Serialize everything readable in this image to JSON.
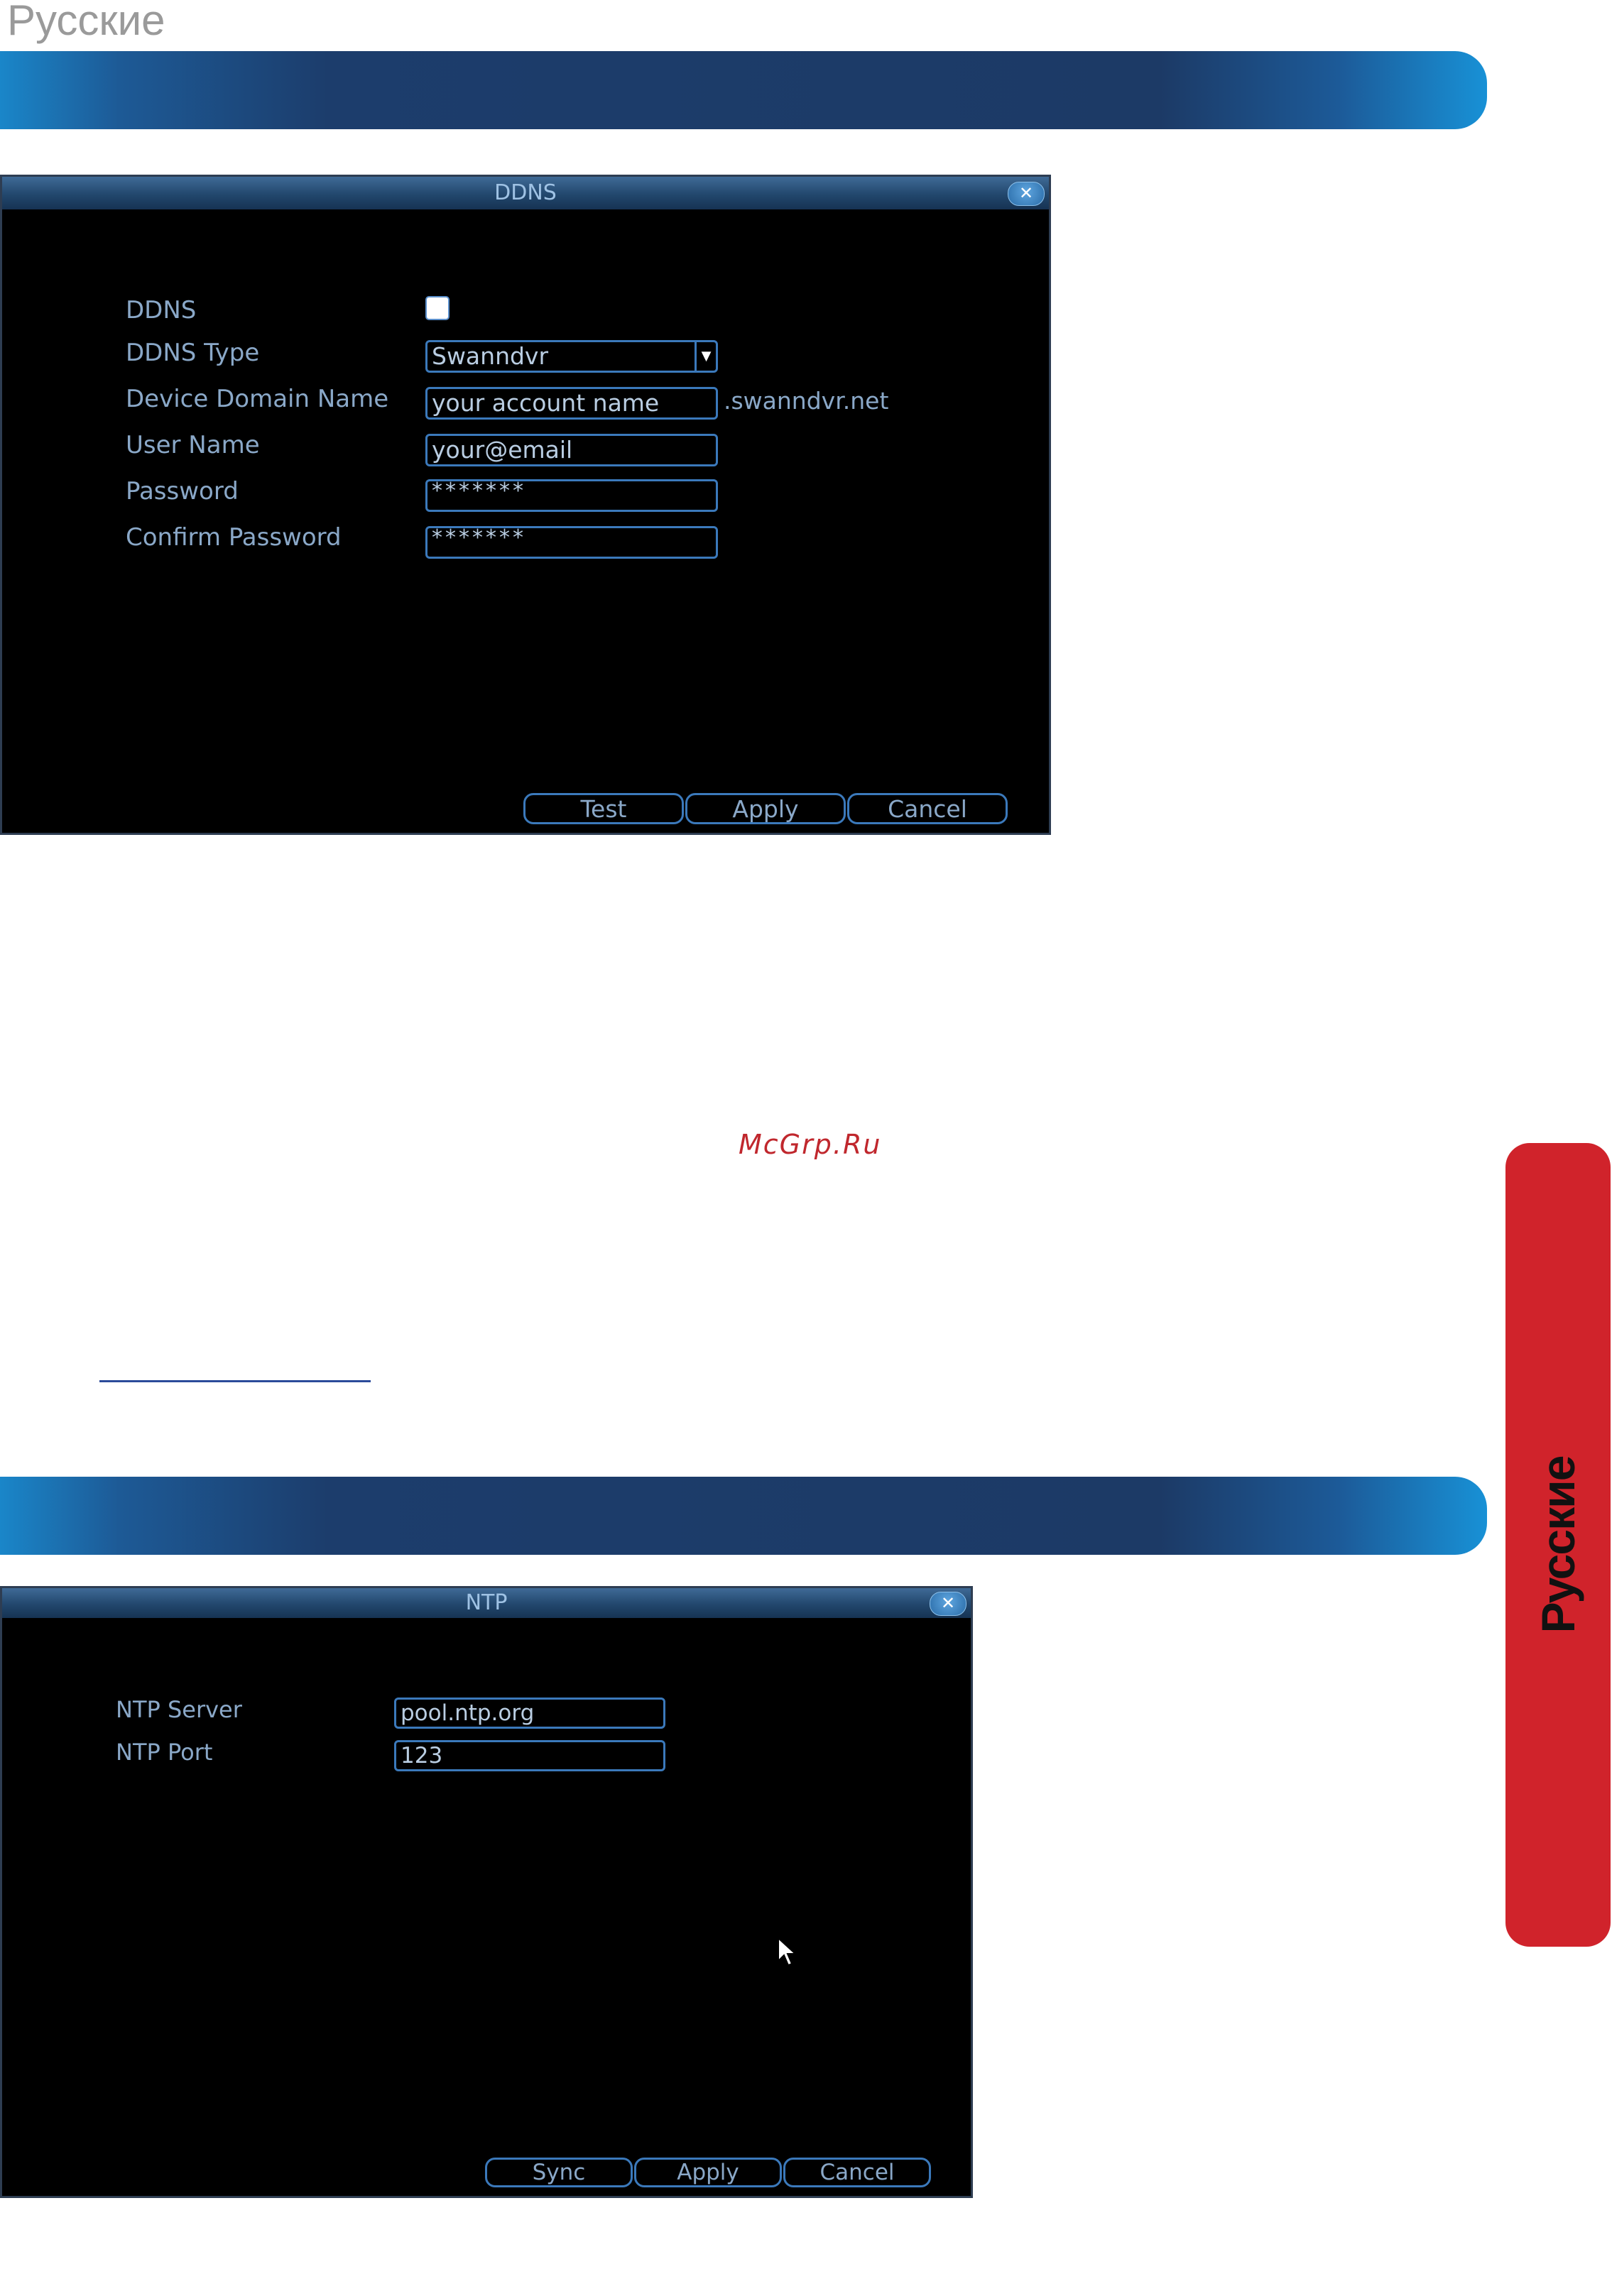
{
  "page": {
    "language_title": "Русские",
    "watermark": "McGrp.Ru",
    "side_tab_text": "Русские"
  },
  "ddns_dialog": {
    "title": "DDNS",
    "close_icon": "close-icon",
    "fields": {
      "ddns_label": "DDNS",
      "ddns_enabled": false,
      "type_label": "DDNS Type",
      "type_value": "Swanndvr",
      "domain_label": "Device Domain Name",
      "domain_value": "your account name",
      "domain_suffix": ".swanndvr.net",
      "user_label": "User Name",
      "user_value": "your@email",
      "password_label": "Password",
      "password_value": "*******",
      "confirm_label": "Confirm Password",
      "confirm_value": "*******"
    },
    "buttons": {
      "test": "Test",
      "apply": "Apply",
      "cancel": "Cancel"
    }
  },
  "ntp_dialog": {
    "title": "NTP",
    "close_icon": "close-icon",
    "fields": {
      "server_label": "NTP Server",
      "server_value": "pool.ntp.org",
      "port_label": "NTP Port",
      "port_value": "123"
    },
    "buttons": {
      "sync": "Sync",
      "apply": "Apply",
      "cancel": "Cancel"
    }
  },
  "colors": {
    "banner_dark": "#1c3a66",
    "banner_light": "#1891d6",
    "side_tab": "#d0232b",
    "watermark": "#c0272d"
  }
}
